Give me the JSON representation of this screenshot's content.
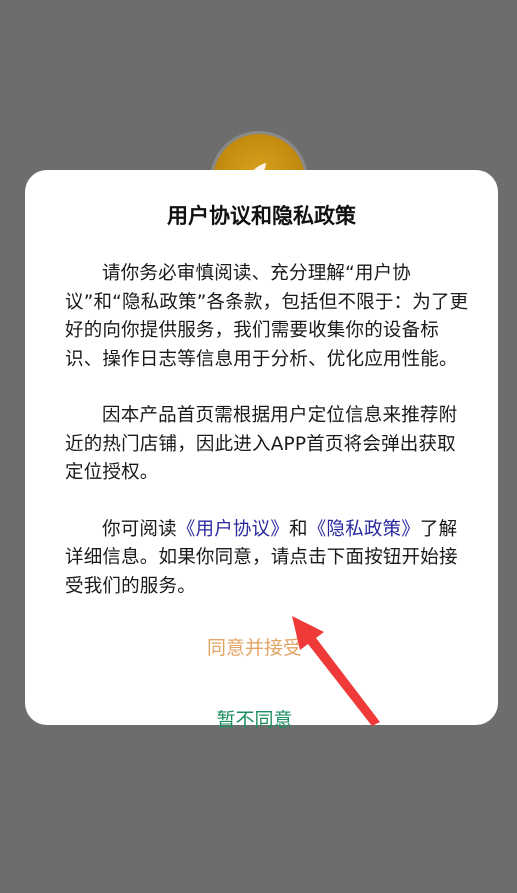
{
  "app": {
    "logo_icon": "app-logo-icon"
  },
  "dialog": {
    "title": "用户协议和隐私政策",
    "para1": "请你务必审慎阅读、充分理解“用户协议”和“隐私政策”各条款，包括但不限于：为了更好的向你提供服务，我们需要收集你的设备标识、操作日志等信息用于分析、优化应用性能。",
    "para2": "因本产品首页需根据用户定位信息来推荐附近的热门店铺，因此进入APP首页将会弹出获取定位授权。",
    "para3_prefix": "你可阅读",
    "user_agreement_link": "《用户协议》",
    "para3_and": "和",
    "privacy_policy_link": "《隐私政策》",
    "para3_suffix": "了解详细信息。如果你同意，请点击下面按钮开始接受我们的服务。",
    "agree_button": "同意并接受",
    "disagree_button": "暂不同意"
  },
  "colors": {
    "overlay": "#6d6d6d",
    "agree": "#e2a566",
    "disagree": "#1c8f62",
    "link": "#2a2aa0",
    "arrow": "#f03a3a"
  }
}
